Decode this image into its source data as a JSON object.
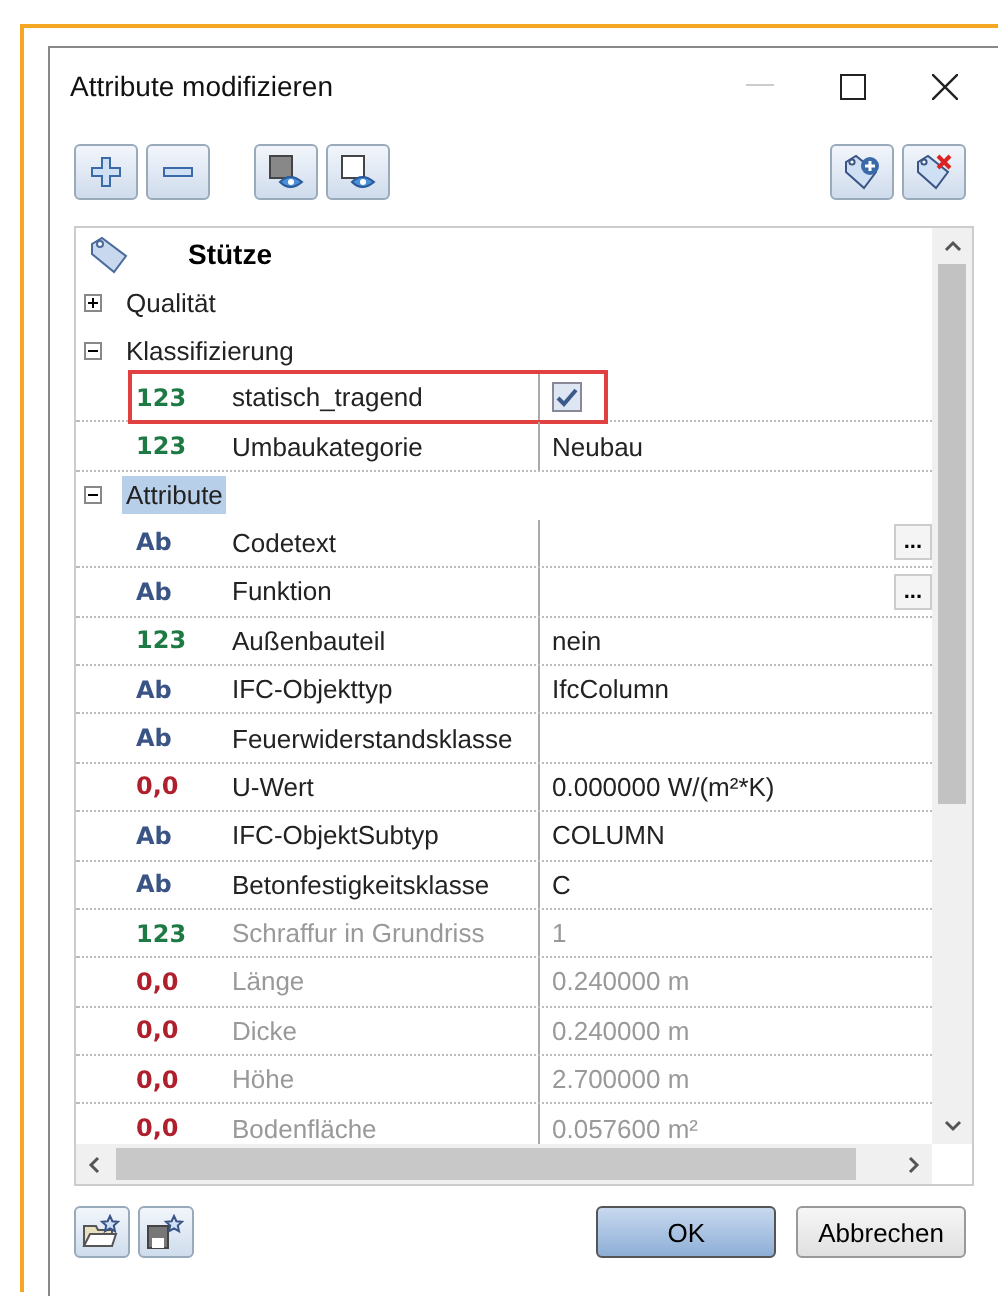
{
  "window": {
    "title": "Attribute modifizieren"
  },
  "toolbar": {
    "left": [
      {
        "kind": "expand"
      },
      {
        "kind": "collapse"
      },
      {
        "kind": "show-numbers"
      },
      {
        "kind": "show-text"
      }
    ],
    "right": [
      {
        "kind": "tag-add"
      },
      {
        "kind": "tag-remove"
      }
    ]
  },
  "grid": {
    "title": "Stütze",
    "groups": [
      {
        "label": "Qualität",
        "expanded": false,
        "selected": false
      },
      {
        "label": "Klassifizierung",
        "expanded": true,
        "selected": false,
        "rows": [
          {
            "color": "#1e7a45",
            "glyph": "123",
            "name": "statisch_tragend",
            "kind": "checkbox",
            "checked": true,
            "disabled": false,
            "highlighted": true
          },
          {
            "color": "#1e7a45",
            "glyph": "123",
            "name": "Umbaukategorie",
            "kind": "value",
            "value": "Neubau",
            "disabled": false,
            "highlighted": false
          }
        ]
      },
      {
        "label": "Attribute",
        "expanded": true,
        "selected": true,
        "rows": [
          {
            "color": "#3a5486",
            "glyph": "Ab",
            "name": "Codetext",
            "kind": "browse",
            "browse": "...",
            "disabled": false,
            "highlighted": false
          },
          {
            "color": "#3a5486",
            "glyph": "Ab",
            "name": "Funktion",
            "kind": "browse",
            "browse": "...",
            "disabled": false,
            "highlighted": false
          },
          {
            "color": "#1e7a45",
            "glyph": "123",
            "name": "Außenbauteil",
            "kind": "value",
            "value": "nein",
            "disabled": false,
            "highlighted": false
          },
          {
            "color": "#3a5486",
            "glyph": "Ab",
            "name": "IFC-Objekttyp",
            "kind": "value",
            "value": "IfcColumn",
            "disabled": false,
            "highlighted": false
          },
          {
            "color": "#3a5486",
            "glyph": "Ab",
            "name": "Feuerwiderstandsklasse",
            "kind": "empty",
            "disabled": false,
            "highlighted": false
          },
          {
            "color": "#b0202c",
            "glyph": "0,0",
            "name": "U-Wert",
            "kind": "value",
            "value": "0.000000 W/(m²*K)",
            "disabled": false,
            "highlighted": false
          },
          {
            "color": "#3a5486",
            "glyph": "Ab",
            "name": "IFC-ObjektSubtyp",
            "kind": "value",
            "value": "COLUMN",
            "disabled": false,
            "highlighted": false
          },
          {
            "color": "#3a5486",
            "glyph": "Ab",
            "name": "Betonfestigkeitsklasse",
            "kind": "value",
            "value": "C",
            "disabled": false,
            "highlighted": false
          },
          {
            "color": "#1e7a45",
            "glyph": "123",
            "name": "Schraffur in Grundriss",
            "kind": "value",
            "value": "1",
            "disabled": true,
            "highlighted": false
          },
          {
            "color": "#b0202c",
            "glyph": "0,0",
            "name": "Länge",
            "kind": "value",
            "value": "0.240000 m",
            "disabled": true,
            "highlighted": false
          },
          {
            "color": "#b0202c",
            "glyph": "0,0",
            "name": "Dicke",
            "kind": "value",
            "value": "0.240000 m",
            "disabled": true,
            "highlighted": false
          },
          {
            "color": "#b0202c",
            "glyph": "0,0",
            "name": "Höhe",
            "kind": "value",
            "value": "2.700000 m",
            "disabled": true,
            "highlighted": false
          },
          {
            "color": "#b0202c",
            "glyph": "0,0",
            "name": "Bodenfläche",
            "kind": "value",
            "value": "0.057600 m²",
            "disabled": true,
            "highlighted": false
          }
        ]
      }
    ]
  },
  "footer": {
    "left": [
      {
        "kind": "open-favorite"
      },
      {
        "kind": "save-favorite"
      }
    ],
    "buttons": [
      {
        "label": "OK",
        "default": true
      },
      {
        "label": "Abbrechen",
        "default": false
      }
    ]
  }
}
